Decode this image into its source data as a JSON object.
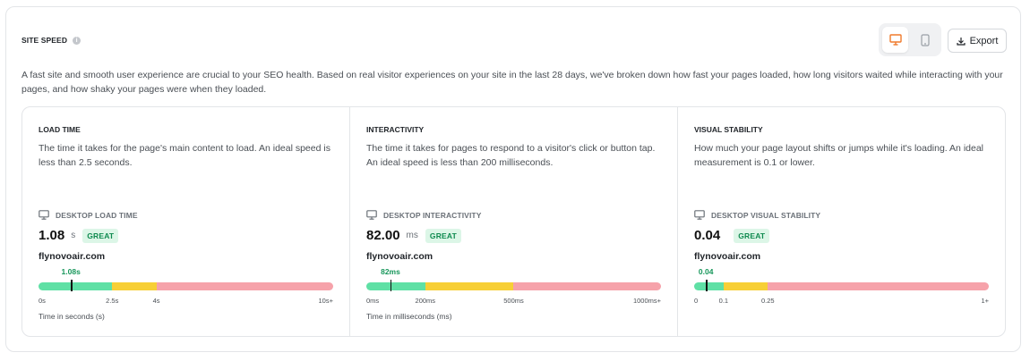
{
  "header": {
    "title": "SITE SPEED",
    "info_icon": "info-icon",
    "export_label": "Export",
    "device_toggle": [
      {
        "name": "desktop",
        "icon": "monitor-icon",
        "active": true
      },
      {
        "name": "mobile",
        "icon": "phone-icon",
        "active": false
      }
    ]
  },
  "intro": "A fast site and smooth user experience are crucial to your SEO health. Based on real visitor experiences on your site in the last 28 days, we've broken down how fast your pages loaded, how long visitors waited while interacting with your pages, and how shaky your pages were when they loaded.",
  "colors": {
    "accent": "#f07a2c",
    "good": "#5fe0a5",
    "needs_improvement": "#f7cf36",
    "poor": "#f6a2aa",
    "badge_text": "#0e8a4f",
    "badge_bg": "#dcf6e7"
  },
  "metrics": [
    {
      "title": "LOAD TIME",
      "description": "The time it takes for the page's main content to load. An ideal speed is less than 2.5 seconds.",
      "label": "DESKTOP LOAD TIME",
      "value": "1.08",
      "unit": "s",
      "badge": "GREAT",
      "site": "flynovoair.com",
      "marker_label": "1.08s",
      "marker_fraction": 0.11,
      "segments": [
        0.25,
        0.15,
        0.6
      ],
      "ticks": [
        {
          "label": "0s",
          "fraction": 0
        },
        {
          "label": "2.5s",
          "fraction": 0.25
        },
        {
          "label": "4s",
          "fraction": 0.4
        },
        {
          "label": "10s+",
          "fraction": 1
        }
      ],
      "axis_note": "Time in seconds (s)"
    },
    {
      "title": "INTERACTIVITY",
      "description": "The time it takes for pages to respond to a visitor's click or button tap. An ideal speed is less than 200 milliseconds.",
      "label": "DESKTOP INTERACTIVITY",
      "value": "82.00",
      "unit": "ms",
      "badge": "GREAT",
      "site": "flynovoair.com",
      "marker_label": "82ms",
      "marker_fraction": 0.082,
      "segments": [
        0.2,
        0.3,
        0.5
      ],
      "ticks": [
        {
          "label": "0ms",
          "fraction": 0
        },
        {
          "label": "200ms",
          "fraction": 0.2
        },
        {
          "label": "500ms",
          "fraction": 0.5
        },
        {
          "label": "1000ms+",
          "fraction": 1
        }
      ],
      "axis_note": "Time in milliseconds (ms)"
    },
    {
      "title": "VISUAL STABILITY",
      "description": "How much your page layout shifts or jumps while it's loading. An ideal measurement is 0.1 or lower.",
      "label": "DESKTOP VISUAL STABILITY",
      "value": "0.04",
      "unit": "",
      "badge": "GREAT",
      "site": "flynovoair.com",
      "marker_label": "0.04",
      "marker_fraction": 0.04,
      "segments": [
        0.1,
        0.15,
        0.75
      ],
      "ticks": [
        {
          "label": "0",
          "fraction": 0
        },
        {
          "label": "0.1",
          "fraction": 0.1
        },
        {
          "label": "0.25",
          "fraction": 0.25
        },
        {
          "label": "1+",
          "fraction": 1
        }
      ],
      "axis_note": ""
    }
  ]
}
